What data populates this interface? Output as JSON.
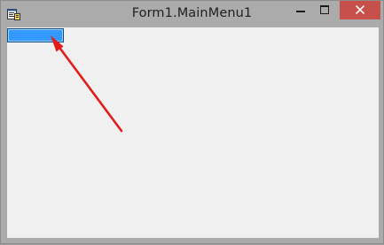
{
  "window": {
    "title": "Form1.MainMenu1",
    "icon": "form-app-icon"
  },
  "caption_buttons": {
    "minimize": "minimize-icon",
    "maximize": "maximize-icon",
    "close": "close-icon"
  },
  "menubar": {
    "items": [
      {
        "label": ""
      }
    ]
  },
  "annotation": {
    "type": "red-arrow",
    "color": "#e21b1b"
  },
  "colors": {
    "menu_highlight": "#3399ff",
    "close_button": "#c7504b",
    "client_background": "#f0f0f0",
    "frame": "#ababab"
  }
}
